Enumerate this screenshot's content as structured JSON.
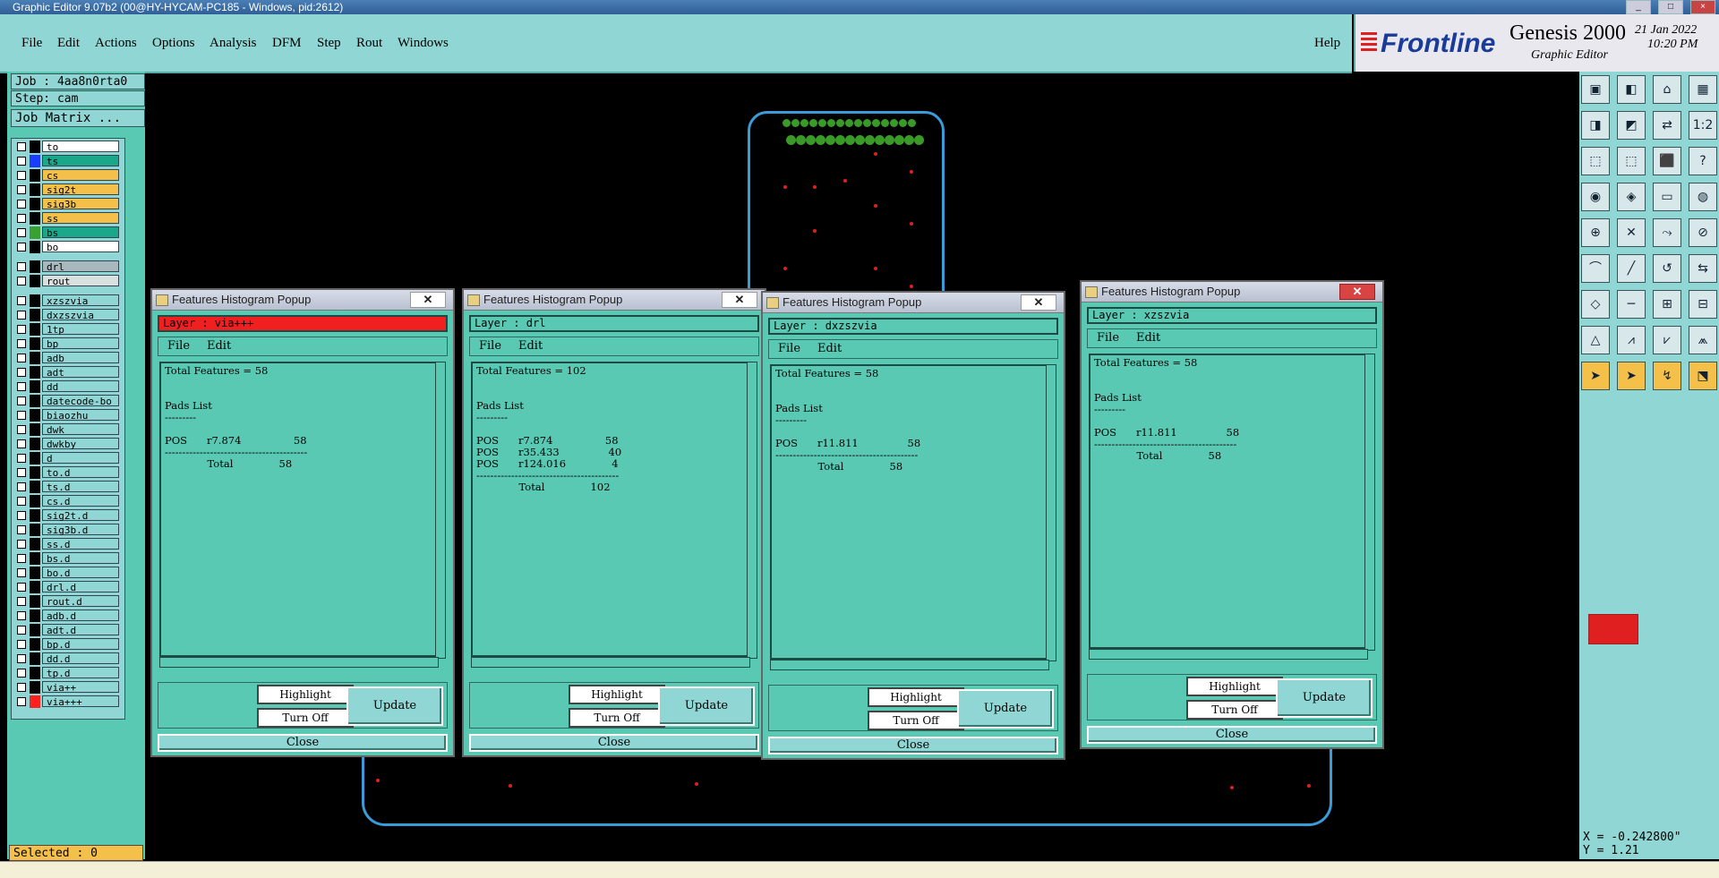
{
  "window": {
    "title": "Graphic Editor 9.07b2 (00@HY-HYCAM-PC185 - Windows, pid:2612)"
  },
  "menu": [
    "File",
    "Edit",
    "Actions",
    "Options",
    "Analysis",
    "DFM",
    "Step",
    "Rout",
    "Windows"
  ],
  "help_label": "Help",
  "brand": {
    "logo": "Frontline",
    "product": "Genesis 2000",
    "subtitle": "Graphic Editor",
    "date": "21 Jan 2022",
    "time": "10:20 PM"
  },
  "job": {
    "job_label": "Job : 4aa8n0rta0",
    "step_label": "Step: cam",
    "matrix_button": "Job Matrix ..."
  },
  "layers": [
    {
      "name": "to",
      "color": "#000000",
      "bg": "#ffffff",
      "selected": false
    },
    {
      "name": "ts",
      "color": "#1a3cff",
      "bg": "#1aa78a",
      "selected": false
    },
    {
      "name": "cs",
      "color": "#000000",
      "bg": "#f4c04a",
      "selected": false
    },
    {
      "name": "sig2t",
      "color": "#000000",
      "bg": "#f4c04a",
      "selected": false
    },
    {
      "name": "sig3b",
      "color": "#000000",
      "bg": "#f4c04a",
      "selected": false
    },
    {
      "name": "ss",
      "color": "#000000",
      "bg": "#f4c04a",
      "selected": false
    },
    {
      "name": "bs",
      "color": "#3aa030",
      "bg": "#1aa78a",
      "selected": true
    },
    {
      "name": "bo",
      "color": "#000000",
      "bg": "#ffffff",
      "selected": false
    },
    {
      "name": "drl",
      "color": "#000000",
      "bg": "#a8b8bc",
      "selected": false
    },
    {
      "name": "rout",
      "color": "#000000",
      "bg": "#d8e0e0",
      "selected": false
    },
    {
      "name": "xzszvia",
      "color": "#000000",
      "bg": "#8fd6d4",
      "selected": false
    },
    {
      "name": "dxzszvia",
      "color": "#000000",
      "bg": "#8fd6d4",
      "selected": false
    },
    {
      "name": "1tp",
      "color": "#000000",
      "bg": "#8fd6d4",
      "selected": false
    },
    {
      "name": "bp",
      "color": "#000000",
      "bg": "#8fd6d4",
      "selected": false
    },
    {
      "name": "adb",
      "color": "#000000",
      "bg": "#8fd6d4",
      "selected": false
    },
    {
      "name": "adt",
      "color": "#000000",
      "bg": "#8fd6d4",
      "selected": false
    },
    {
      "name": "dd",
      "color": "#000000",
      "bg": "#8fd6d4",
      "selected": false
    },
    {
      "name": "datecode-bo",
      "color": "#000000",
      "bg": "#8fd6d4",
      "selected": false
    },
    {
      "name": "biaozhu",
      "color": "#000000",
      "bg": "#8fd6d4",
      "selected": false
    },
    {
      "name": "dwk",
      "color": "#000000",
      "bg": "#8fd6d4",
      "selected": false
    },
    {
      "name": "dwkby",
      "color": "#000000",
      "bg": "#8fd6d4",
      "selected": false
    },
    {
      "name": "d",
      "color": "#000000",
      "bg": "#8fd6d4",
      "selected": false
    },
    {
      "name": "to.d",
      "color": "#000000",
      "bg": "#8fd6d4",
      "selected": false
    },
    {
      "name": "ts.d",
      "color": "#000000",
      "bg": "#8fd6d4",
      "selected": false
    },
    {
      "name": "cs.d",
      "color": "#000000",
      "bg": "#8fd6d4",
      "selected": false
    },
    {
      "name": "sig2t.d",
      "color": "#000000",
      "bg": "#8fd6d4",
      "selected": false
    },
    {
      "name": "sig3b.d",
      "color": "#000000",
      "bg": "#8fd6d4",
      "selected": false
    },
    {
      "name": "ss.d",
      "color": "#000000",
      "bg": "#8fd6d4",
      "selected": false
    },
    {
      "name": "bs.d",
      "color": "#000000",
      "bg": "#8fd6d4",
      "selected": false
    },
    {
      "name": "bo.d",
      "color": "#000000",
      "bg": "#8fd6d4",
      "selected": false
    },
    {
      "name": "drl.d",
      "color": "#000000",
      "bg": "#8fd6d4",
      "selected": false
    },
    {
      "name": "rout.d",
      "color": "#000000",
      "bg": "#8fd6d4",
      "selected": false
    },
    {
      "name": "adb.d",
      "color": "#000000",
      "bg": "#8fd6d4",
      "selected": false
    },
    {
      "name": "adt.d",
      "color": "#000000",
      "bg": "#8fd6d4",
      "selected": false
    },
    {
      "name": "bp.d",
      "color": "#000000",
      "bg": "#8fd6d4",
      "selected": false
    },
    {
      "name": "dd.d",
      "color": "#000000",
      "bg": "#8fd6d4",
      "selected": false
    },
    {
      "name": "tp.d",
      "color": "#000000",
      "bg": "#8fd6d4",
      "selected": false
    },
    {
      "name": "via++",
      "color": "#000000",
      "bg": "#8fd6d4",
      "selected": false
    },
    {
      "name": "via+++",
      "color": "#ff2020",
      "bg": "#8fd6d4",
      "selected": false
    }
  ],
  "selected_label": "Selected : 0",
  "coords": {
    "x": "X = -0.242800\"",
    "y": "Y = 1.21"
  },
  "popups": [
    {
      "title": "Features Histogram Popup",
      "layer": "Layer :  via+++",
      "menu_file": "File",
      "menu_edit": "Edit",
      "highlight": "Highlight",
      "turn_off": "Turn Off",
      "update": "Update",
      "close": "Close",
      "text": "Total Features = 58\n\n\nPads List\n---------\n\nPOS      r7.874                58\n-----------------------------------------\n             Total              58"
    },
    {
      "title": "Features Histogram Popup",
      "layer": "Layer :  drl",
      "menu_file": "File",
      "menu_edit": "Edit",
      "highlight": "Highlight",
      "turn_off": "Turn Off",
      "update": "Update",
      "close": "Close",
      "text": "Total Features = 102\n\n\nPads List\n---------\n\nPOS      r7.874                58\nPOS      r35.433               40\nPOS      r124.016              4\n-----------------------------------------\n             Total              102"
    },
    {
      "title": "Features Histogram Popup",
      "layer": "Layer :  dxzszvia",
      "menu_file": "File",
      "menu_edit": "Edit",
      "highlight": "Highlight",
      "turn_off": "Turn Off",
      "update": "Update",
      "close": "Close",
      "text": "Total Features = 58\n\n\nPads List\n---------\n\nPOS      r11.811               58\n-----------------------------------------\n             Total              58"
    },
    {
      "title": "Features Histogram Popup",
      "layer": "Layer :  xzszvia",
      "menu_file": "File",
      "menu_edit": "Edit",
      "highlight": "Highlight",
      "turn_off": "Turn Off",
      "update": "Update",
      "close": "Close",
      "text": "Total Features = 58\n\n\nPads List\n---------\n\nPOS      r11.811               58\n-----------------------------------------\n             Total              58"
    }
  ],
  "toolbar_icons": [
    "save-icon",
    "open-icon",
    "home-icon",
    "grid-icon",
    "zoom-in-icon",
    "zoom-out-icon",
    "zoom-fit-icon",
    "one-to-one-icon",
    "undo-icon",
    "redo-icon",
    "measure-icon",
    "pad-icon",
    "select-icon",
    "line-icon",
    "arc-icon",
    "text-icon"
  ],
  "toolbar_labels": [
    "1:2",
    "?"
  ]
}
